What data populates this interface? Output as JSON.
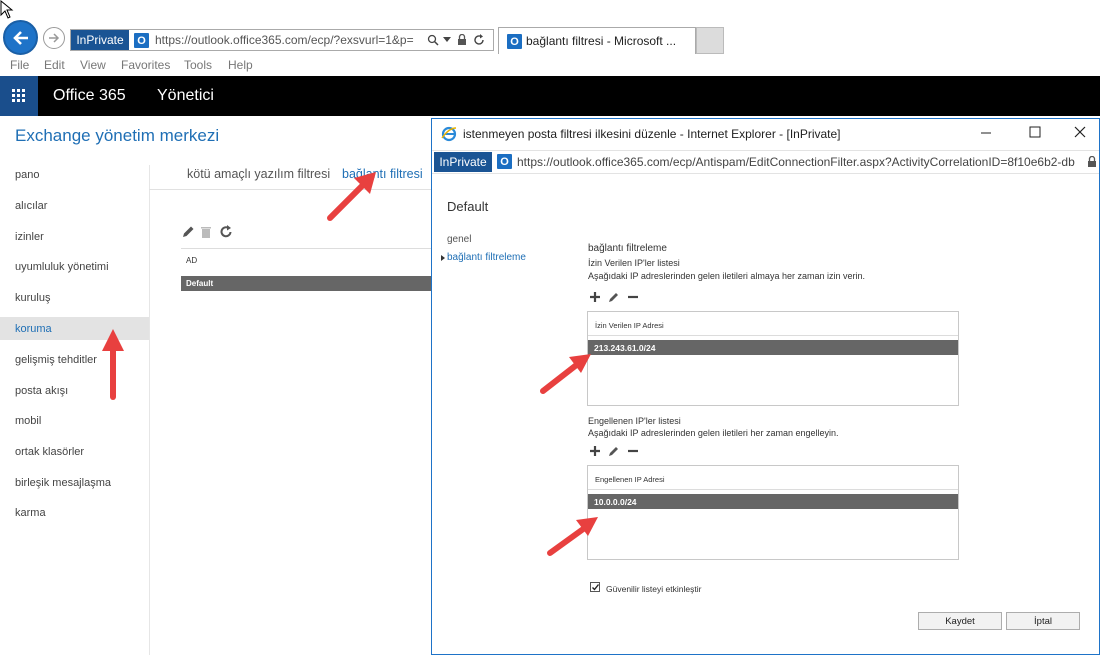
{
  "browser": {
    "inprivate_label": "InPrivate",
    "address_url": "https://outlook.office365.com/ecp/?exsvurl=1&p=",
    "tab_title": "bağlantı filtresi - Microsoft ...",
    "menu": [
      "File",
      "Edit",
      "View",
      "Favorites",
      "Tools",
      "Help"
    ]
  },
  "o365": {
    "brand": "Office 365",
    "section": "Yönetici"
  },
  "eac": {
    "title": "Exchange yönetim merkezi",
    "nav": [
      "pano",
      "alıcılar",
      "izinler",
      "uyumluluk yönetimi",
      "kuruluş",
      "koruma",
      "gelişmiş tehditler",
      "posta akışı",
      "mobil",
      "ortak klasörler",
      "birleşik mesajlaşma",
      "karma"
    ],
    "selected_nav": "koruma",
    "tabs": [
      "kötü amaçlı yazılım filtresi",
      "bağlantı filtresi"
    ],
    "active_tab": "bağlantı filtresi",
    "table_header": "AD",
    "table_rows": [
      "Default"
    ]
  },
  "popup": {
    "window_title": "istenmeyen posta filtresi ilkesini düzenle - Internet Explorer - [InPrivate]",
    "inprivate_label": "InPrivate",
    "url": "https://outlook.office365.com/ecp/Antispam/EditConnectionFilter.aspx?ActivityCorrelationID=8f10e6b2-db",
    "heading": "Default",
    "side_nav": [
      "genel",
      "bağlantı filtreleme"
    ],
    "active_side_nav": "bağlantı filtreleme",
    "section_title": "bağlantı filtreleme",
    "allowed": {
      "title": "İzin Verilen IP'ler listesi",
      "description": "Aşağıdaki IP adreslerinden gelen iletileri almaya her zaman izin verin.",
      "column": "İzin Verilen IP Adresi",
      "rows": [
        "213.243.61.0/24"
      ]
    },
    "blocked": {
      "title": "Engellenen IP'ler listesi",
      "description": "Aşağıdaki IP adreslerinden gelen iletileri her zaman engelleyin.",
      "column": "Engellenen IP Adresi",
      "rows": [
        "10.0.0.0/24"
      ]
    },
    "safe_list_label": "Güvenilir listeyi etkinleştir",
    "safe_list_checked": true,
    "save_label": "Kaydet",
    "cancel_label": "İptal"
  },
  "colors": {
    "accent_blue": "#1f6fb5",
    "inprivate_bg": "#1a5494",
    "selected_row": "#666666",
    "annotation_arrow": "#e8403f"
  }
}
